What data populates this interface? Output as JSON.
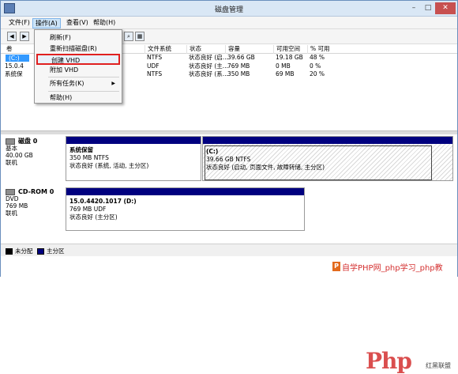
{
  "window": {
    "title": "磁盘管理",
    "minimize": "–",
    "maximize": "□",
    "close": "✕"
  },
  "menubar": {
    "file": "文件(F)",
    "action": "操作(A)",
    "view": "查看(V)",
    "help": "帮助(H)"
  },
  "action_menu": {
    "items": [
      "刷新(F)",
      "重新扫描磁盘(R)",
      "创建 VHD",
      "附加 VHD",
      "所有任务(K)",
      "帮助(H)"
    ],
    "highlighted": "创建 VHD",
    "submenu_arrow": "▶"
  },
  "volume_table": {
    "columns": [
      "卷",
      "文件系统",
      "状态",
      "容量",
      "可用空间",
      "% 可用"
    ],
    "rows": [
      {
        "volume": "(C:)",
        "fs": "NTFS",
        "status": "状态良好 (启...",
        "capacity": "39.66 GB",
        "free": "19.18 GB",
        "pct": "48 %"
      },
      {
        "volume": "15.0.4",
        "fs": "UDF",
        "status": "状态良好 (主...",
        "capacity": "769 MB",
        "free": "0 MB",
        "pct": "0 %"
      },
      {
        "volume": "系统保",
        "fs": "NTFS",
        "status": "状态良好 (系...",
        "capacity": "350 MB",
        "free": "69 MB",
        "pct": "20 %"
      }
    ]
  },
  "disks": [
    {
      "name": "磁盘 0",
      "type": "基本",
      "size": "40.00 GB",
      "state": "联机",
      "partitions": [
        {
          "title": "系统保留",
          "detail": "350 MB NTFS",
          "status": "状态良好 (系统, 活动, 主分区)"
        },
        {
          "title": "(C:)",
          "detail": "39.66 GB NTFS",
          "status": "状态良好 (启动, 页面文件, 故障转储, 主分区)"
        }
      ]
    },
    {
      "name": "CD-ROM 0",
      "type": "DVD",
      "size": "769 MB",
      "state": "联机",
      "partitions": [
        {
          "title": "15.0.4420.1017  (D:)",
          "detail": "769 MB UDF",
          "status": "状态良好 (主分区)"
        }
      ]
    }
  ],
  "legend": {
    "unallocated": "未分配",
    "primary": "主分区"
  },
  "watermark": {
    "logo": "Php",
    "cn": "红黑联盟",
    "footer": "自学PHP网_php学习_php教",
    "p": "P"
  },
  "colors": {
    "partition_bar": "#00007f",
    "unallocated": "#000000",
    "primary": "#00007f",
    "highlight_border": "#e02020",
    "selection": "#3399ff"
  }
}
